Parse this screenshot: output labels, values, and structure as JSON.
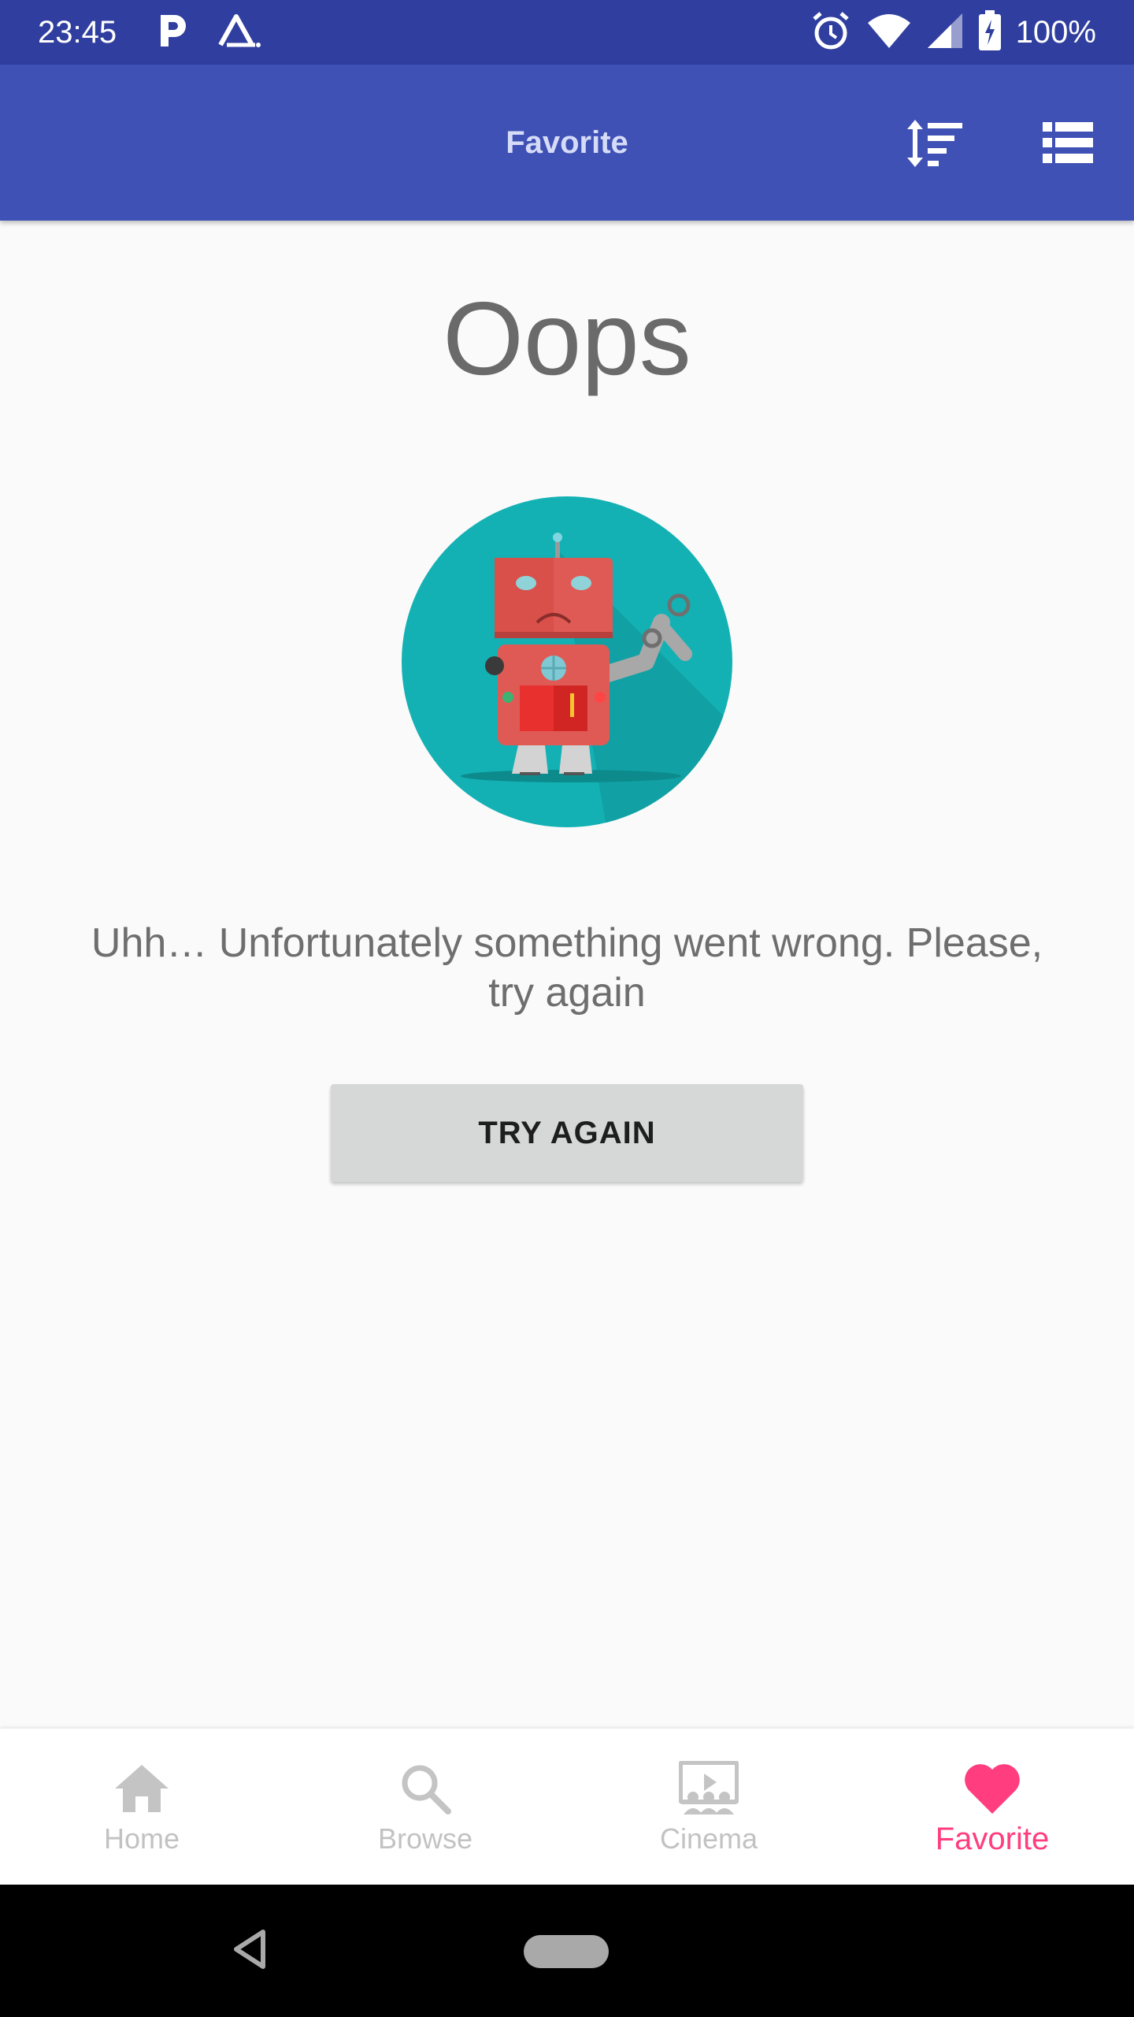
{
  "status_bar": {
    "time": "23:45",
    "battery": "100%",
    "icons": [
      "p-app-icon",
      "a-app-icon",
      "alarm-icon",
      "wifi-icon",
      "signal-icon",
      "battery-charging-icon"
    ]
  },
  "app_bar": {
    "title": "Favorite",
    "actions": [
      "sort-icon",
      "list-view-icon"
    ]
  },
  "error": {
    "title": "Oops",
    "message": "Uhh… Unfortunately something went wrong. Please, try again",
    "button_label": "TRY AGAIN",
    "illustration": "broken-robot"
  },
  "bottom_nav": {
    "items": [
      {
        "label": "Home",
        "icon": "home-icon",
        "active": false
      },
      {
        "label": "Browse",
        "icon": "search-icon",
        "active": false
      },
      {
        "label": "Cinema",
        "icon": "cinema-icon",
        "active": false
      },
      {
        "label": "Favorite",
        "icon": "heart-icon",
        "active": true
      }
    ]
  },
  "colors": {
    "status_bar": "#303f9f",
    "app_bar": "#3f51b5",
    "accent": "#ff3d7f",
    "illustration_bg": "#14b1b4"
  }
}
